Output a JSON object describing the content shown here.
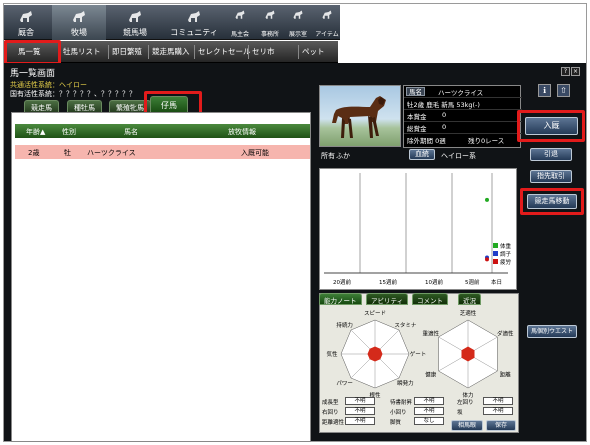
{
  "topnav": [
    {
      "id": "home",
      "label": "厩舎"
    },
    {
      "id": "ranch",
      "label": "牧場"
    },
    {
      "id": "racetrack",
      "label": "競馬場"
    },
    {
      "id": "community",
      "label": "コミュニティ"
    },
    {
      "id": "owners",
      "label": "馬主会"
    },
    {
      "id": "office",
      "label": "事務所"
    },
    {
      "id": "forum",
      "label": "展示室"
    },
    {
      "id": "items",
      "label": "アイテム"
    }
  ],
  "subnav": [
    "馬一覧",
    "牡馬リスト",
    "即日繁殖",
    "競走馬購入",
    "セレクトセール",
    "セリ市",
    "ペット"
  ],
  "header": {
    "title": "馬一覧画面",
    "common": "共通活性系統：ヘイロー",
    "national": "国有活性系統：？？？？？、？？？？？"
  },
  "tabs": [
    "競走馬",
    "種牡馬",
    "繁殖牝馬",
    "仔馬"
  ],
  "table": {
    "headers": [
      "年齢▲",
      "性別",
      "馬名",
      "放牧情報"
    ],
    "rows": [
      [
        "2歳",
        "牡",
        "ハーツクライス",
        "入厩可能"
      ]
    ]
  },
  "horse": {
    "name_label": "馬名",
    "name": "ハーツクライス",
    "line1": "牡2歳 鹿毛 新馬 53kg(-)",
    "earnings_label": "本賞金",
    "earnings": "0",
    "total_label": "総賞金",
    "total": "0",
    "exclusion": "除外期間 0週",
    "remaining": "残り0レース",
    "owner_label": "所有",
    "owner": "ふか",
    "blood_btn": "血統",
    "blood": "ヘイロー系"
  },
  "buttons": {
    "admit": "入厩",
    "retire": "引退",
    "transfer": "指先取引",
    "move": "競走馬移動",
    "profile": "馬個別ウエスト",
    "history": "相馬眼",
    "save": "保存"
  },
  "window_controls": [
    "?",
    "×"
  ],
  "chart_data": {
    "type": "scatter",
    "x_ticks": [
      "20週前",
      "15週前",
      "10週前",
      "5週前",
      "本日"
    ],
    "legend": [
      "体重",
      "調子",
      "疲労"
    ],
    "colors": [
      "#22aa22",
      "#1e3cc8",
      "#cc1111"
    ],
    "series": [
      {
        "name": "体重",
        "x": [
          0
        ],
        "y": [
          0.72
        ]
      },
      {
        "name": "調子",
        "x": [
          0
        ],
        "y": [
          0.12
        ]
      },
      {
        "name": "疲労",
        "x": [
          0
        ],
        "y": [
          0.1
        ]
      }
    ]
  },
  "bottom_tabs": [
    "能力ノート",
    "アビリティ",
    "コメント",
    "近況"
  ],
  "radar1": {
    "labels": [
      "スピード",
      "スタミナ",
      "ゲート",
      "瞬発力",
      "根性",
      "パワー",
      "気性",
      "持続力"
    ],
    "center": "?"
  },
  "radar2": {
    "labels": [
      "芝適性",
      "ダ適性",
      "距離",
      "体力",
      "健康",
      "重適性"
    ],
    "center": "?"
  },
  "props": [
    {
      "l": "成長型",
      "v": "不明"
    },
    {
      "l": "待書耐昇",
      "v": "不明"
    },
    {
      "l": "左回り",
      "v": "不明"
    },
    {
      "l": "右回り",
      "v": "不明"
    },
    {
      "l": "小回り",
      "v": "不明"
    },
    {
      "l": "坂",
      "v": "不明"
    },
    {
      "l": "距離適性",
      "v": "不明"
    },
    {
      "l": "脚質",
      "v": "なし"
    }
  ]
}
